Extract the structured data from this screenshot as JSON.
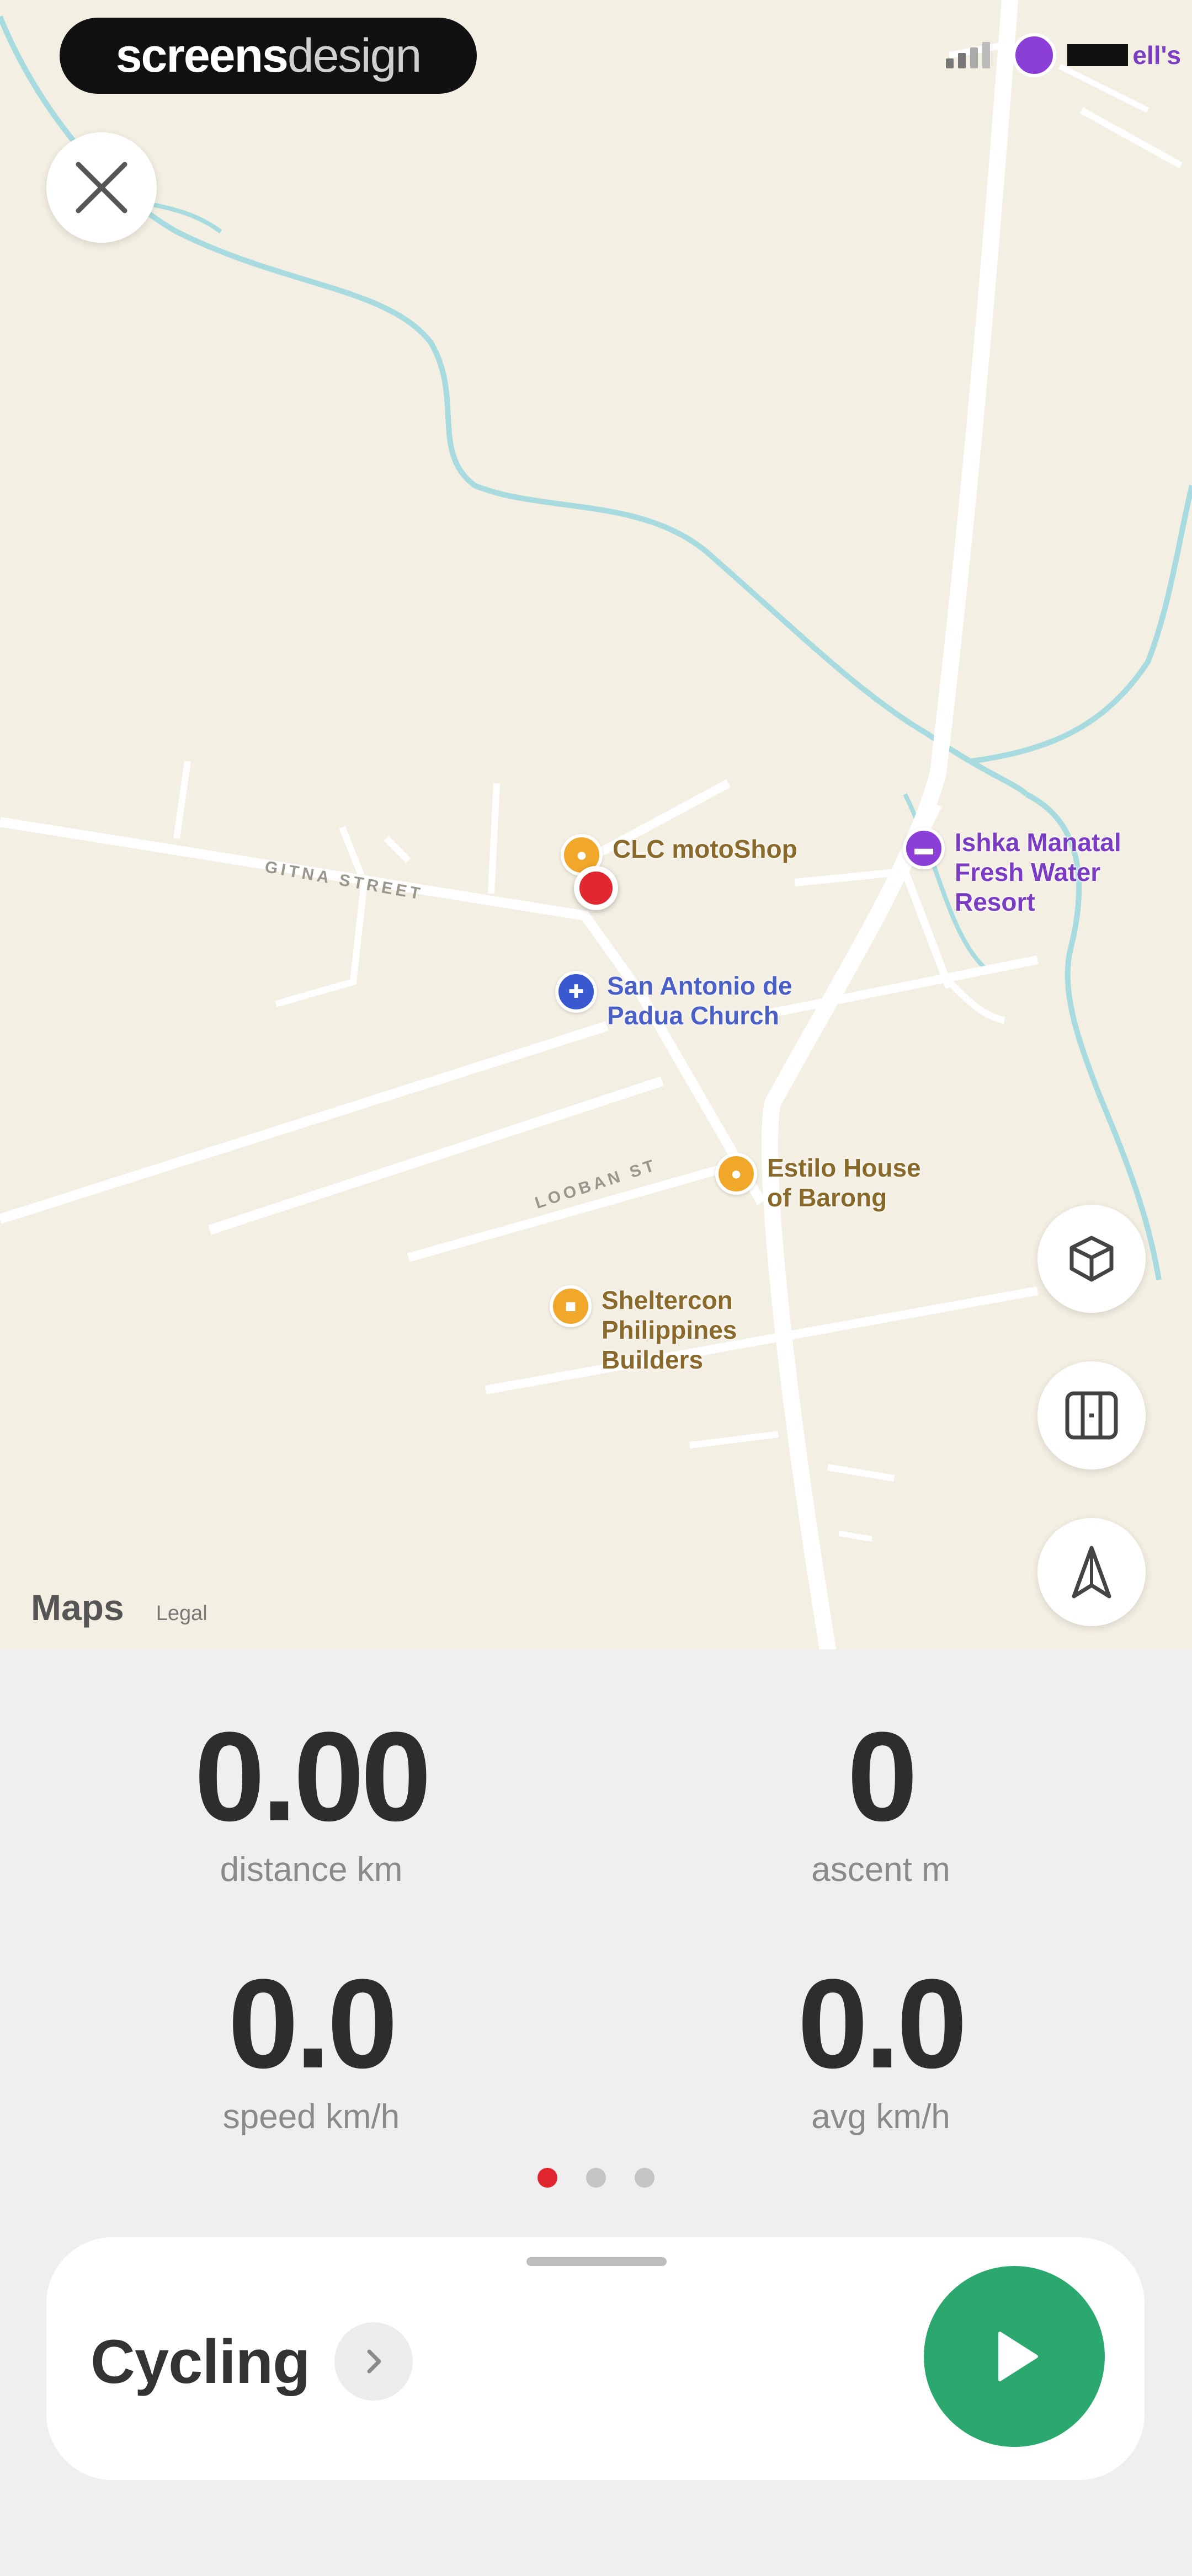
{
  "watermark": {
    "bold": "screens",
    "light": "design"
  },
  "status_bar": {
    "place_suffix": "ell's"
  },
  "map": {
    "streets": [
      {
        "label": "GITNA STREET"
      },
      {
        "label": "LOOBAN ST"
      }
    ],
    "pois": [
      {
        "name": "CLC motoShop",
        "icon": "shopping-bag-icon"
      },
      {
        "name": "Ishka Manatal\nFresh Water\nResort",
        "icon": "hotel-icon"
      },
      {
        "name": "San Antonio de\nPadua Church",
        "icon": "church-icon"
      },
      {
        "name": "Estilo House\nof Barong",
        "icon": "shopping-bag-icon"
      },
      {
        "name": "Sheltercon\nPhilippines\nBuilders",
        "icon": "briefcase-icon"
      }
    ],
    "attribution": {
      "logo": "Maps",
      "legal": "Legal"
    }
  },
  "stats": {
    "distance": {
      "value": "0.00",
      "label": "distance km"
    },
    "ascent": {
      "value": "0",
      "label": "ascent m"
    },
    "speed": {
      "value": "0.0",
      "label": "speed km/h"
    },
    "avg": {
      "value": "0.0",
      "label": "avg km/h"
    }
  },
  "pager": {
    "count": 3,
    "active": 0
  },
  "activity": {
    "label": "Cycling"
  },
  "colors": {
    "accent_red": "#e0262e",
    "start_green": "#2aa86e",
    "map_bg": "#f4efe3",
    "water": "#a8dbdf"
  }
}
